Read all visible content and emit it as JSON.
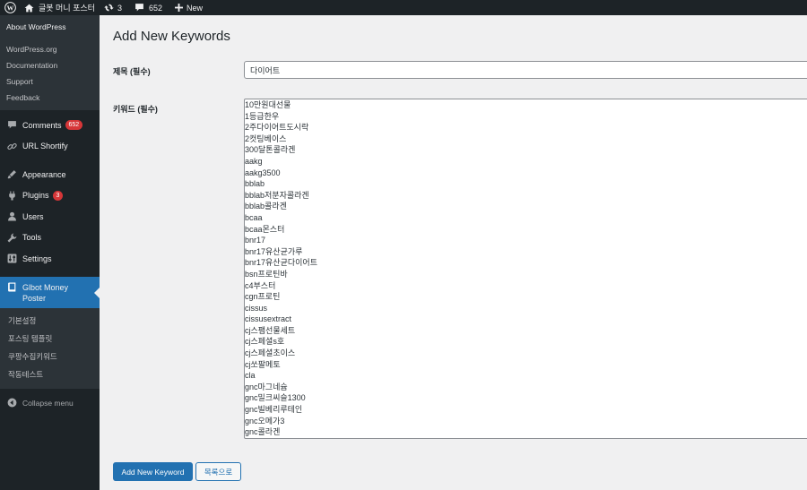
{
  "admin_bar": {
    "site_name": "글봇 머니 포스터",
    "updates_count": "3",
    "comments_count": "652",
    "new_label": "New"
  },
  "sidebar": {
    "top_submenu": [
      "About WordPress",
      "WordPress.org",
      "Documentation",
      "Support",
      "Feedback"
    ],
    "menu": {
      "comments": {
        "label": "Comments",
        "badge": "652"
      },
      "url_shortify": {
        "label": "URL Shortify"
      },
      "appearance": {
        "label": "Appearance"
      },
      "plugins": {
        "label": "Plugins",
        "badge": "3"
      },
      "users": {
        "label": "Users"
      },
      "tools": {
        "label": "Tools"
      },
      "settings": {
        "label": "Settings"
      },
      "current": {
        "label": "Glbot Money Poster"
      }
    },
    "current_submenu": [
      "기본설정",
      "포스팅 템플릿",
      "쿠팡수집키워드",
      "작동테스트"
    ],
    "collapse_label": "Collapse menu"
  },
  "main": {
    "page_title": "Add New Keywords",
    "title_label": "제목 (필수)",
    "title_value": "다이어트",
    "keywords_label": "키워드 (필수)",
    "keywords": [
      "10만원대선물",
      "1등급한우",
      "2주다이어트도시락",
      "2컷팅베이스",
      "300달톤콜라겐",
      "aakg",
      "aakg3500",
      "bblab",
      "bblab저분자콜라겐",
      "bblab콜라겐",
      "bcaa",
      "bcaa몬스터",
      "bnr17",
      "bnr17유산균가루",
      "bnr17유산균다이어트",
      "bsn프로틴바",
      "c4부스터",
      "cgn프로틴",
      "cissus",
      "cissusextract",
      "cj스팸선물세트",
      "cj스페셜s호",
      "cj스페셜초이스",
      "cj쏘팔메토",
      "cla",
      "gnc마그네슘",
      "gnc밀크씨슬1300",
      "gnc빌베리루테인",
      "gnc오메가3",
      "gnc콜라겐"
    ],
    "submit_label": "Add New Keyword",
    "back_label": "목록으로"
  },
  "colors": {
    "admin_dark": "#1d2327",
    "submenu_dark": "#2c3338",
    "accent_blue": "#2271b1",
    "badge_red": "#d63638",
    "content_bg": "#f0f0f1"
  }
}
